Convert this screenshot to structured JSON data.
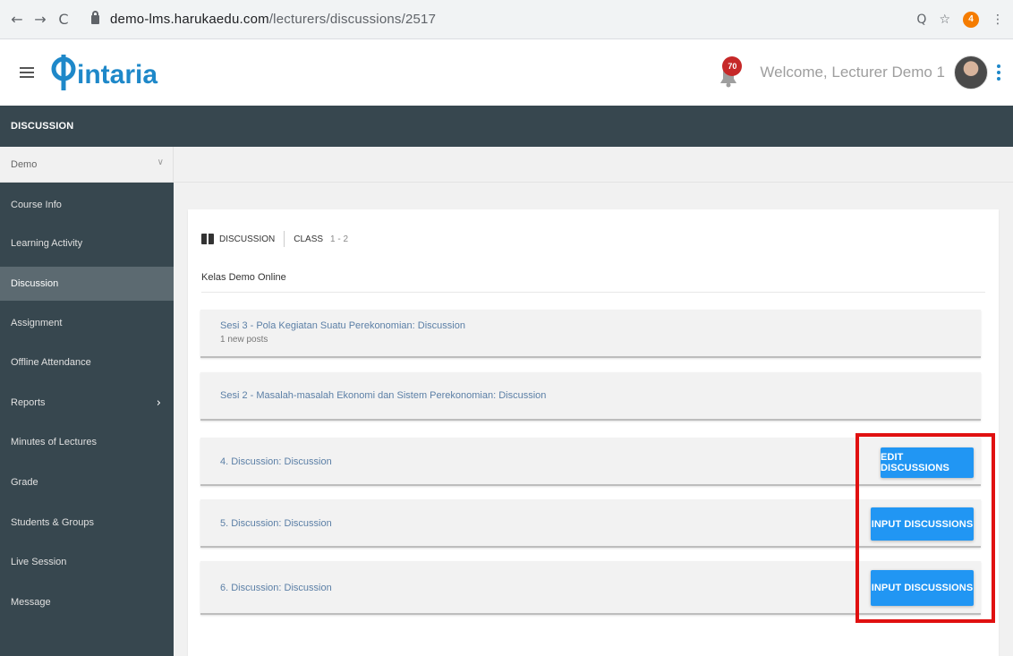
{
  "browser": {
    "back_icon": "←",
    "forward_icon": "→",
    "reload_icon": "C",
    "url_host": "demo-lms.harukaedu.com",
    "url_path": "/lecturers/discussions/2517",
    "zoom_icon": "Q",
    "star_icon": "☆",
    "ext_badge": "4",
    "menu_icon": "⋮"
  },
  "header": {
    "logo_text": "intaria",
    "notification_count": "70",
    "welcome_text": "Welcome, Lecturer Demo 1"
  },
  "page_title": "DISCUSSION",
  "course_select": {
    "value": "Demo",
    "chevron": "∨"
  },
  "sidebar": {
    "items": [
      {
        "label": "Course Info"
      },
      {
        "label": "Learning Activity"
      },
      {
        "label": "Discussion"
      },
      {
        "label": "Assignment"
      },
      {
        "label": "Offline Attendance"
      },
      {
        "label": "Reports",
        "arrow": "›"
      },
      {
        "label": "Minutes of Lectures"
      },
      {
        "label": "Grade"
      },
      {
        "label": "Students & Groups"
      },
      {
        "label": "Live Session"
      },
      {
        "label": "Message"
      }
    ]
  },
  "card": {
    "head_label": "DISCUSSION",
    "class_label": "CLASS",
    "class_value": "1 - 2",
    "subtitle": "Kelas Demo Online",
    "discussions": [
      {
        "title": "Sesi 3 - Pola Kegiatan Suatu Perekonomian: Discussion",
        "subtitle": "1 new posts",
        "button": ""
      },
      {
        "title": "Sesi 2 - Masalah-masalah Ekonomi dan Sistem Perekonomian: Discussion",
        "subtitle": "",
        "button": ""
      },
      {
        "title": "4. Discussion: Discussion",
        "subtitle": "",
        "button": "EDIT DISCUSSIONS"
      },
      {
        "title": "5. Discussion: Discussion",
        "subtitle": "",
        "button": "INPUT DISCUSSIONS"
      },
      {
        "title": "6. Discussion: Discussion",
        "subtitle": "",
        "button": "INPUT DISCUSSIONS"
      }
    ]
  },
  "colors": {
    "sidebar_bg": "#37474f",
    "active_item": "#5c6a71",
    "button_blue": "#2196f3",
    "highlight_red": "#e01010",
    "logo_blue": "#1e88c9"
  }
}
